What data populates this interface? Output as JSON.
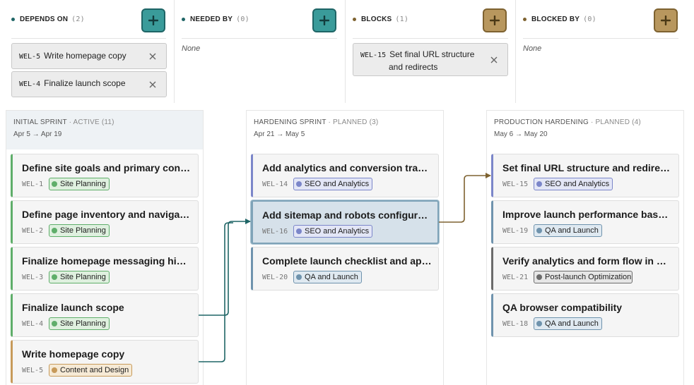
{
  "dependencies": {
    "depends_on": {
      "label": "DEPENDS ON",
      "count": "(2)",
      "add_label": "+",
      "items": [
        {
          "key": "WEL-5",
          "title": "Write homepage copy"
        },
        {
          "key": "WEL-4",
          "title": "Finalize launch scope"
        }
      ]
    },
    "needed_by": {
      "label": "NEEDED BY",
      "count": "(0)",
      "add_label": "+",
      "empty": "None"
    },
    "blocks": {
      "label": "BLOCKS",
      "count": "(1)",
      "add_label": "+",
      "items": [
        {
          "key": "WEL-15",
          "title_line1": "Set final URL structure",
          "title_line2": "and redirects"
        }
      ]
    },
    "blocked_by": {
      "label": "BLOCKED BY",
      "count": "(0)",
      "add_label": "+",
      "empty": "None"
    }
  },
  "sprints": [
    {
      "name": "INITIAL SPRINT",
      "status": " · ACTIVE (11)",
      "dates": "Apr 5 → Apr 19",
      "cards": [
        {
          "title": "Define site goals and primary conversion paths",
          "key": "WEL-1",
          "tag": "Site Planning"
        },
        {
          "title": "Define page inventory and navigation structure",
          "key": "WEL-2",
          "tag": "Site Planning"
        },
        {
          "title": "Finalize homepage messaging hierarchy",
          "key": "WEL-3",
          "tag": "Site Planning"
        },
        {
          "title": "Finalize launch scope",
          "key": "WEL-4",
          "tag": "Site Planning"
        },
        {
          "title": "Write homepage copy",
          "key": "WEL-5",
          "tag": "Content and Design"
        }
      ]
    },
    {
      "name": "HARDENING SPRINT",
      "status": " · PLANNED (3)",
      "dates": "Apr 21 → May 5",
      "cards": [
        {
          "title": "Add analytics and conversion tracking",
          "key": "WEL-14",
          "tag": "SEO and Analytics"
        },
        {
          "title": "Add sitemap and robots configuration",
          "key": "WEL-16",
          "tag": "SEO and Analytics"
        },
        {
          "title": "Complete launch checklist and approvals",
          "key": "WEL-20",
          "tag": "QA and Launch"
        }
      ]
    },
    {
      "name": "PRODUCTION HARDENING",
      "status": " · PLANNED (4)",
      "dates": "May 6 → May 20",
      "cards": [
        {
          "title": "Set final URL structure and redirects",
          "key": "WEL-15",
          "tag": "SEO and Analytics"
        },
        {
          "title": "Improve launch performance baselines",
          "key": "WEL-19",
          "tag": "QA and Launch"
        },
        {
          "title": "Verify analytics and form flow in production",
          "key": "WEL-21",
          "tag": "Post-launch Optimization"
        },
        {
          "title": "QA browser compatibility",
          "key": "WEL-18",
          "tag": "QA and Launch"
        }
      ]
    }
  ],
  "colors": {
    "teal": "#1f6566",
    "tan": "#7e6230",
    "site_planning": "#5fae6a",
    "content_design": "#c79a5a",
    "seo_analytics": "#7b86c9",
    "qa_launch": "#6f93ad",
    "post_launch": "#6b6b6b"
  },
  "icons": {
    "add": "plus-icon",
    "remove": "close-icon",
    "arrow": "dependency-arrow"
  }
}
